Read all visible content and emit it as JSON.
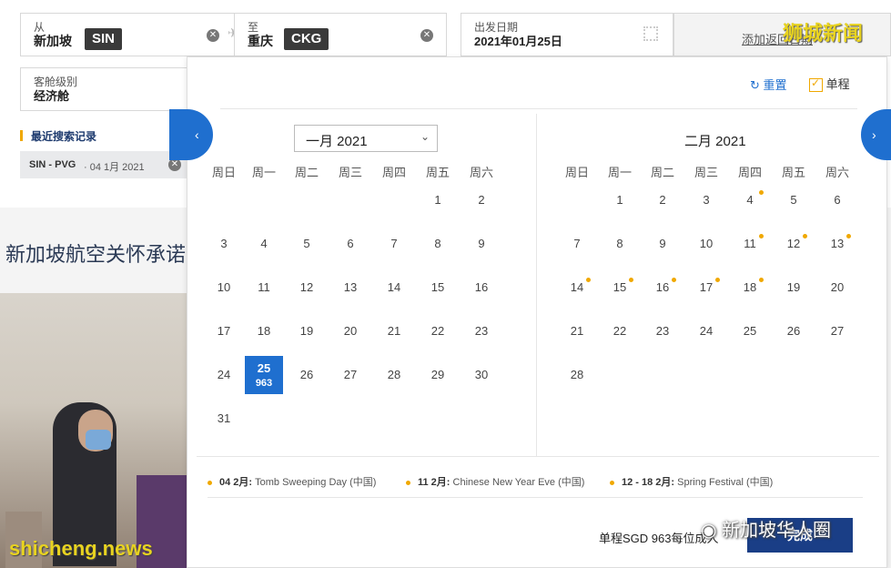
{
  "search": {
    "from_label": "从",
    "from_city": "新加坡",
    "from_code": "SIN",
    "to_label": "至",
    "to_city": "重庆",
    "to_code": "CKG",
    "date_label": "出发日期",
    "date_value": "2021年01月25日",
    "add_return": "添加返回日期",
    "cabin_label": "客舱级别",
    "cabin_value": "经济舱",
    "recent_title": "最近搜索记录",
    "recent_item": "SIN - PVG",
    "recent_date": "· 04 1月 2021"
  },
  "background": {
    "banner_text": "新加坡航空关怀承诺"
  },
  "calendar": {
    "reset": "重置",
    "oneway": "单程",
    "left_month": "一月 2021",
    "right_month": "二月 2021",
    "weekdays": [
      "周日",
      "周一",
      "周二",
      "周三",
      "周四",
      "周五",
      "周六"
    ],
    "selected_price": "963",
    "legend": [
      {
        "date": "04 2月:",
        "name": "Tomb Sweeping Day (中国)"
      },
      {
        "date": "11 2月:",
        "name": "Chinese New Year Eve (中国)"
      },
      {
        "date": "12 - 18 2月:",
        "name": "Spring Festival (中国)"
      }
    ],
    "footer_price": "单程SGD 963每位成人",
    "done": "完成"
  },
  "watermarks": {
    "top_right": "狮城新闻",
    "bottom_left": "shicheng.news",
    "bottom_right": "新加坡华人圈"
  }
}
